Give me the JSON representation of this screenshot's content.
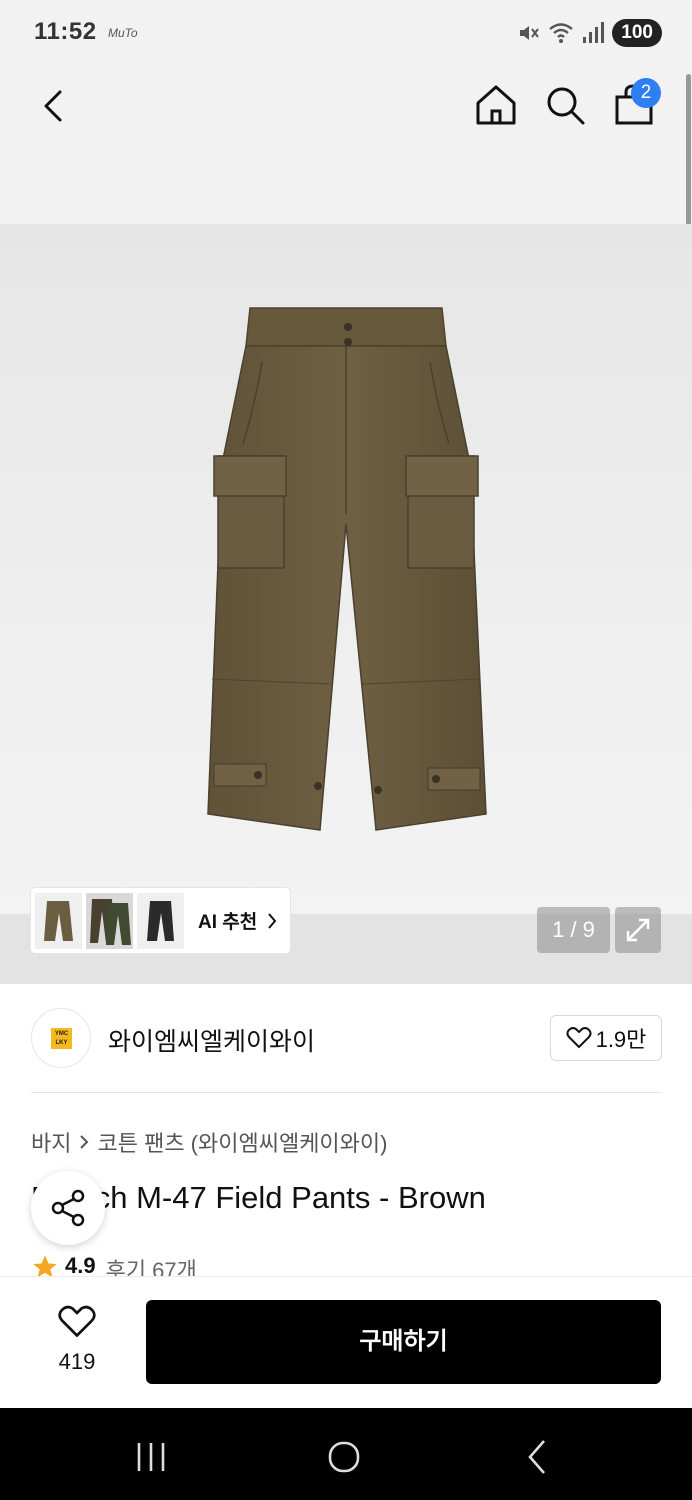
{
  "status_bar": {
    "time": "11:52",
    "app_indicator": "MuTo",
    "battery": "100",
    "icons": [
      "mute-icon",
      "wifi-icon",
      "signal-icon"
    ]
  },
  "nav": {
    "cart_count": "2",
    "icons": [
      "back-arrow-icon",
      "home-icon",
      "search-icon",
      "shopping-bag-icon"
    ]
  },
  "gallery": {
    "ai_label": "AI 추천",
    "current": "1",
    "total": "9",
    "counter": "1 / 9",
    "thumbnail_colors": [
      "#6b5d3f",
      "#3f4a30",
      "#2b2b2b"
    ]
  },
  "brand": {
    "name": "와이엠씨엘케이와이",
    "logo_text": "YMC LKY",
    "likes": "1.9만"
  },
  "breadcrumb": {
    "category": "바지",
    "subcategory": "코튼 팬츠 (와이엠씨엘케이와이)"
  },
  "product": {
    "title": "French M-47 Field Pants - Brown",
    "rating": "4.9",
    "reviews": "후기 67개"
  },
  "actions": {
    "wish_count": "419",
    "buy_label": "구매하기"
  },
  "colors": {
    "accent": "#2f7ef2",
    "buy_button": "#000000",
    "star": "#f5a623",
    "pants_fabric": "#6b5d3f"
  }
}
